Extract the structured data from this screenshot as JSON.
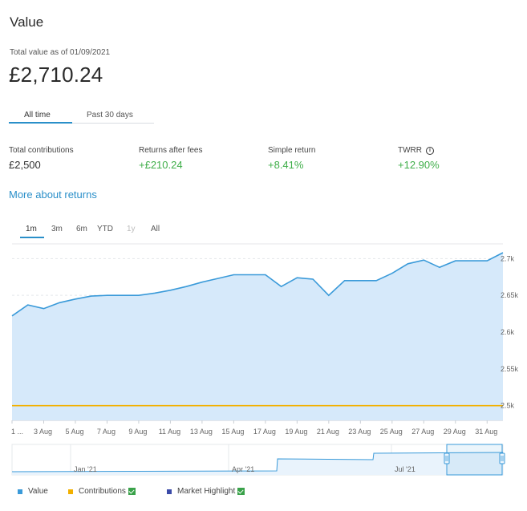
{
  "header": {
    "title": "Value",
    "as_of": "Total value as of 01/09/2021",
    "total_value": "£2,710.24"
  },
  "tabs": [
    {
      "label": "All time",
      "active": true
    },
    {
      "label": "Past 30 days",
      "active": false
    }
  ],
  "stats": [
    {
      "label": "Total contributions",
      "value": "£2,500",
      "positive": false
    },
    {
      "label": "Returns after fees",
      "value": "+£210.24",
      "positive": true
    },
    {
      "label": "Simple return",
      "value": "+8.41%",
      "positive": true
    },
    {
      "label": "TWRR",
      "value": "+12.90%",
      "positive": true,
      "info_icon": "info-icon"
    }
  ],
  "more_link": "More about returns",
  "ranges": [
    {
      "label": "1m",
      "active": true,
      "disabled": false
    },
    {
      "label": "3m",
      "active": false,
      "disabled": false
    },
    {
      "label": "6m",
      "active": false,
      "disabled": false
    },
    {
      "label": "YTD",
      "active": false,
      "disabled": false
    },
    {
      "label": "1y",
      "active": false,
      "disabled": true
    },
    {
      "label": "All",
      "active": false,
      "disabled": false
    }
  ],
  "colors": {
    "accent": "#2a8fc9",
    "value_line": "#3a9ad9",
    "value_fill": "#d6e9fa",
    "contributions": "#f2b000",
    "highlight": "#3b4ba8",
    "positive": "#3fae49"
  },
  "legend": [
    {
      "label": "Value",
      "color": "#3a9ad9",
      "checkbox": false
    },
    {
      "label": "Contributions",
      "color": "#f2b000",
      "checkbox": true
    },
    {
      "label": "Market Highlight",
      "color": "#3b4ba8",
      "checkbox": true
    }
  ],
  "chart_data": {
    "type": "area",
    "ylim": [
      2480,
      2720
    ],
    "y_ticks": [
      2500,
      2550,
      2600,
      2650,
      2700
    ],
    "y_tick_labels": [
      "2.5k",
      "2.55k",
      "2.6k",
      "2.65k",
      "2.7k"
    ],
    "x_tick_labels": [
      "1 ...",
      "3 Aug",
      "5 Aug",
      "7 Aug",
      "9 Aug",
      "11 Aug",
      "13 Aug",
      "15 Aug",
      "17 Aug",
      "19 Aug",
      "21 Aug",
      "23 Aug",
      "25 Aug",
      "27 Aug",
      "29 Aug",
      "31 Aug"
    ],
    "x_tick_days": [
      1,
      3,
      5,
      7,
      9,
      11,
      13,
      15,
      17,
      19,
      21,
      23,
      25,
      27,
      29,
      31
    ],
    "x_range_days": [
      1,
      32
    ],
    "series": [
      {
        "name": "Value",
        "x_days": [
          1,
          2,
          3,
          4,
          5,
          6,
          7,
          8,
          9,
          10,
          11,
          12,
          13,
          14,
          15,
          16,
          17,
          18,
          19,
          20,
          21,
          22,
          23,
          24,
          25,
          26,
          27,
          28,
          29,
          30,
          31,
          32
        ],
        "values": [
          2622,
          2637,
          2632,
          2640,
          2645,
          2649,
          2650,
          2650,
          2650,
          2653,
          2657,
          2662,
          2668,
          2673,
          2678,
          2678,
          2678,
          2662,
          2674,
          2672,
          2650,
          2670,
          2670,
          2670,
          2680,
          2693,
          2698,
          2688,
          2697,
          2697,
          2697,
          2708
        ]
      },
      {
        "name": "Contributions",
        "x_days": [
          1,
          32
        ],
        "values": [
          2500,
          2500
        ]
      }
    ],
    "navigator": {
      "labels": [
        "Jan '21",
        "Apr '21",
        "Jul '21"
      ]
    }
  }
}
